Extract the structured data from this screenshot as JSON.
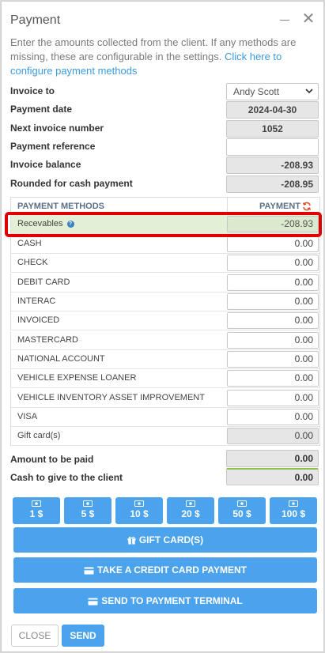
{
  "dialog": {
    "title": "Payment",
    "description": "Enter the amounts collected from the client. If any methods are missing, these are configurable in the settings.",
    "link": "Click here to configure payment methods"
  },
  "fields": {
    "invoice_to": {
      "label": "Invoice to",
      "value": "Andy Scott"
    },
    "payment_date": {
      "label": "Payment date",
      "value": "2024-04-30"
    },
    "next_invoice": {
      "label": "Next invoice number",
      "value": "1052"
    },
    "payment_reference": {
      "label": "Payment reference",
      "value": ""
    },
    "invoice_balance": {
      "label": "Invoice balance",
      "value": "-208.93"
    },
    "rounded_cash": {
      "label": "Rounded for cash payment",
      "value": "-208.95"
    }
  },
  "table": {
    "header_methods": "PAYMENT METHODS",
    "header_payment": "PAYMENT",
    "rows": [
      {
        "method": "Recevables",
        "amount": "-208.93"
      },
      {
        "method": "CASH",
        "amount": "0.00"
      },
      {
        "method": "CHECK",
        "amount": "0.00"
      },
      {
        "method": "DEBIT CARD",
        "amount": "0.00"
      },
      {
        "method": "INTERAC",
        "amount": "0.00"
      },
      {
        "method": "INVOICED",
        "amount": "0.00"
      },
      {
        "method": "MASTERCARD",
        "amount": "0.00"
      },
      {
        "method": "NATIONAL ACCOUNT",
        "amount": "0.00"
      },
      {
        "method": "VEHICLE EXPENSE LOANER",
        "amount": "0.00"
      },
      {
        "method": "VEHICLE INVENTORY ASSET IMPROVEMENT",
        "amount": "0.00"
      },
      {
        "method": "VISA",
        "amount": "0.00"
      },
      {
        "method": "Gift card(s)",
        "amount": "0.00"
      }
    ]
  },
  "totals": {
    "amount_to_pay": {
      "label": "Amount to be paid",
      "value": "0.00"
    },
    "cash_to_give": {
      "label": "Cash to give to the client",
      "value": "0.00"
    }
  },
  "cash_buttons": [
    "1 $",
    "5 $",
    "10 $",
    "20 $",
    "50 $",
    "100 $"
  ],
  "actions": {
    "gift_card": "GIFT CARD(S)",
    "credit_card": "TAKE A CREDIT CARD PAYMENT",
    "terminal": "SEND TO PAYMENT TERMINAL"
  },
  "footer": {
    "close": "CLOSE",
    "send": "SEND"
  },
  "colors": {
    "accent": "#4aa3ec",
    "highlight": "#e00000",
    "recevables_bg": "#e3efd6"
  }
}
